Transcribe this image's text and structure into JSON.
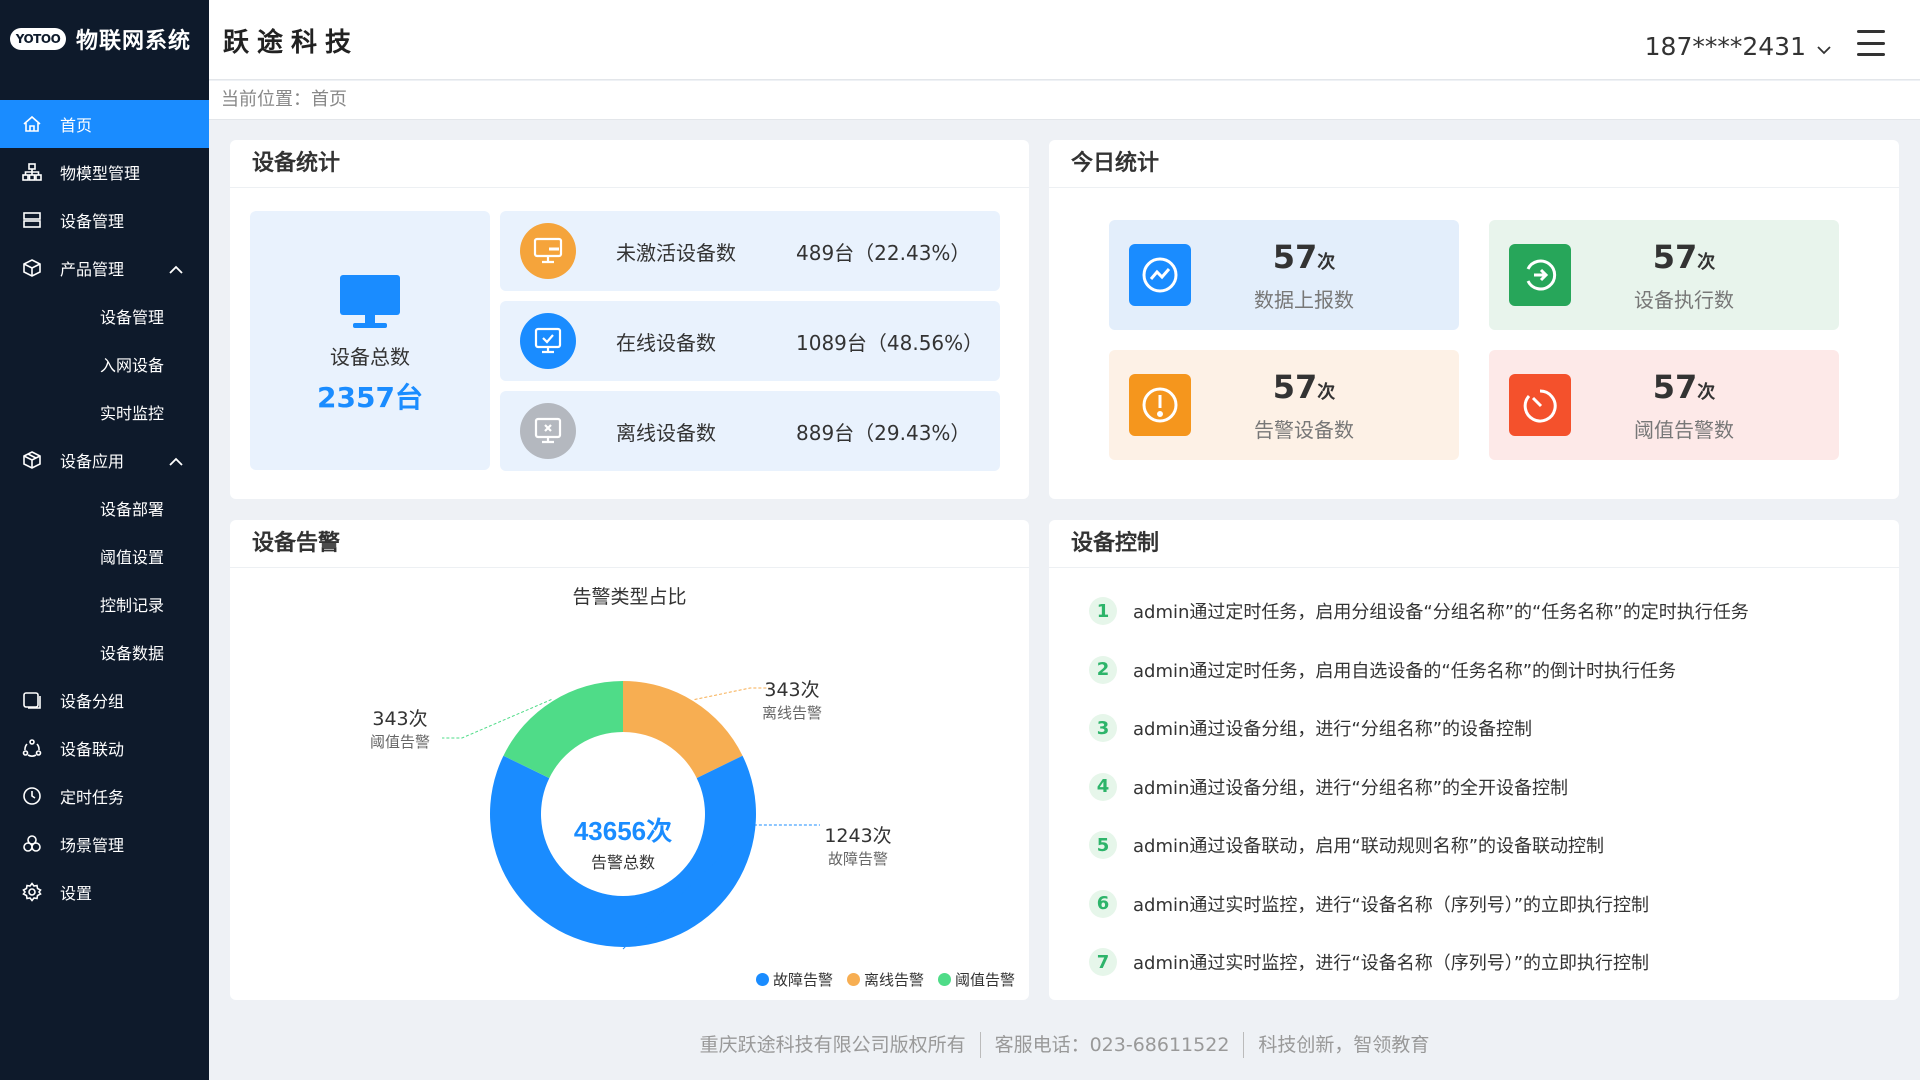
{
  "app": {
    "logo_badge": "YOTOO",
    "title": "物联网系统",
    "company": "跃途科技"
  },
  "header": {
    "user": "187****2431",
    "breadcrumb": "当前位置：首页"
  },
  "sidebar": {
    "items": [
      {
        "label": "首页",
        "icon": "home-icon"
      },
      {
        "label": "物模型管理",
        "icon": "sitemap-icon"
      },
      {
        "label": "设备管理",
        "icon": "server-icon"
      },
      {
        "label": "产品管理",
        "icon": "cube-icon"
      },
      {
        "label": "设备管理"
      },
      {
        "label": "入网设备"
      },
      {
        "label": "实时监控"
      },
      {
        "label": "设备应用",
        "icon": "package-icon"
      },
      {
        "label": "设备部署"
      },
      {
        "label": "阈值设置"
      },
      {
        "label": "控制记录"
      },
      {
        "label": "设备数据"
      },
      {
        "label": "设备分组",
        "icon": "group-icon"
      },
      {
        "label": "设备联动",
        "icon": "link-icon"
      },
      {
        "label": "定时任务",
        "icon": "clock-icon"
      },
      {
        "label": "场景管理",
        "icon": "scene-icon"
      },
      {
        "label": "设置",
        "icon": "gear-icon"
      }
    ]
  },
  "device_stats": {
    "title": "设备统计",
    "total_label": "设备总数",
    "total_value": "2357台",
    "rows": [
      {
        "label": "未激活设备数",
        "value": "489台（22.43%）",
        "color": "#f5a43b"
      },
      {
        "label": "在线设备数",
        "value": "1089台（48.56%）",
        "color": "#1a8cff"
      },
      {
        "label": "离线设备数",
        "value": "889台（29.43%）",
        "color": "#b4b8bf"
      }
    ]
  },
  "today_stats": {
    "title": "今日统计",
    "cards": [
      {
        "num": "57",
        "unit": "次",
        "label": "数据上报数",
        "color": "#1a8cff",
        "bg": "#e3eefb"
      },
      {
        "num": "57",
        "unit": "次",
        "label": "设备执行数",
        "color": "#27a65a",
        "bg": "#e8f4ec"
      },
      {
        "num": "57",
        "unit": "次",
        "label": "告警设备数",
        "color": "#f5961d",
        "bg": "#fdf1e6"
      },
      {
        "num": "57",
        "unit": "次",
        "label": "阈值告警数",
        "color": "#f4512c",
        "bg": "#fde9e8"
      }
    ]
  },
  "alarm": {
    "title": "设备告警",
    "center_value": "43656次",
    "center_label": "告警总数",
    "labels": [
      {
        "value": "343次",
        "name": "离线告警"
      },
      {
        "value": "343次",
        "name": "阈值告警"
      },
      {
        "value": "1243次",
        "name": "故障告警"
      }
    ]
  },
  "chart_data": {
    "type": "pie",
    "title": "告警类型占比",
    "categories": [
      "故障告警",
      "离线告警",
      "阈值告警"
    ],
    "values": [
      1243,
      343,
      343
    ],
    "colors": [
      "#1a8cff",
      "#f7ae52",
      "#4fdc88"
    ],
    "legend": "bottom-right"
  },
  "control": {
    "title": "设备控制",
    "items": [
      "admin通过定时任务，启用分组设备“分组名称”的“任务名称”的定时执行任务",
      "admin通过定时任务，启用自选设备的“任务名称”的倒计时执行任务",
      "admin通过设备分组，进行“分组名称”的设备控制",
      "admin通过设备分组，进行“分组名称”的全开设备控制",
      "admin通过设备联动，启用“联动规则名称”的设备联动控制",
      "admin通过实时监控，进行“设备名称（序列号）”的立即执行控制",
      "admin通过实时监控，进行“设备名称（序列号）”的立即执行控制"
    ]
  },
  "footer": {
    "copyright": "重庆跃途科技有限公司版权所有",
    "phone": "客服电话：023-68611522",
    "slogan": "科技创新，智领教育"
  }
}
